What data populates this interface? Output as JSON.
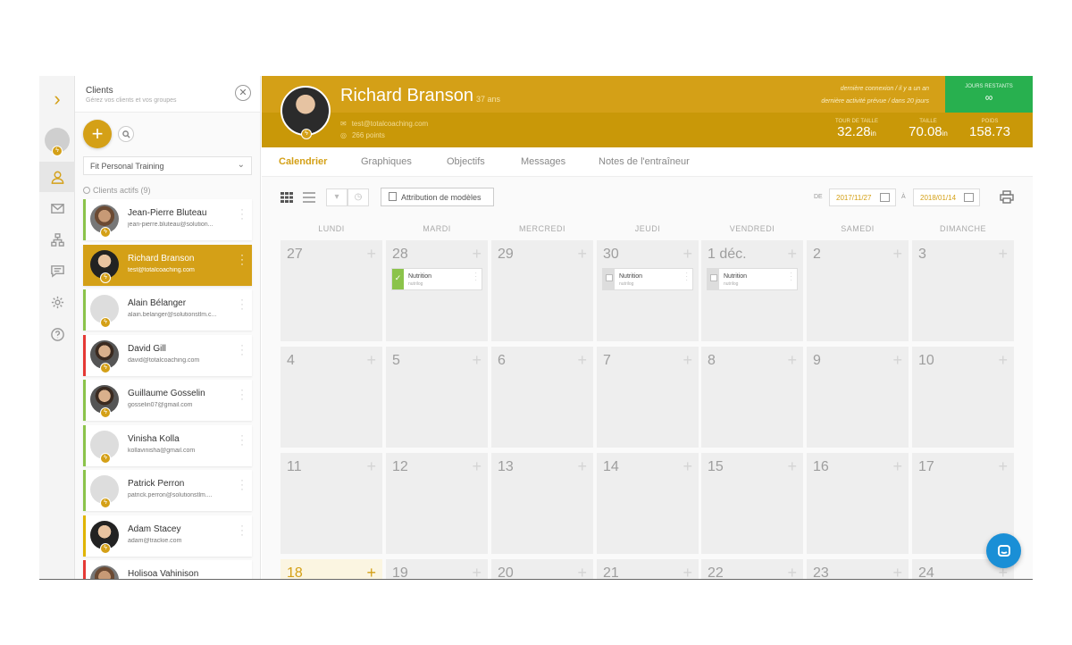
{
  "colors": {
    "accent": "#d4a017",
    "green": "#28b04f",
    "ok": "#8bc34a",
    "danger": "#e53935",
    "chat": "#1a8fd6"
  },
  "rail": {
    "icons": [
      "chevron-right-icon",
      "avatar",
      "clients-icon",
      "mail-icon",
      "hierarchy-icon",
      "chat-icon",
      "gear-icon",
      "help-icon"
    ]
  },
  "clients": {
    "title": "Clients",
    "subtitle": "Gérez vos clients et vos groupes",
    "add": "+",
    "group": "Fit Personal Training",
    "active_label": "Clients actifs",
    "active_count": "(9)",
    "list": [
      {
        "name": "Jean-Pierre Bluteau",
        "email": "jean-pierre.bluteau@solution..."
      },
      {
        "name": "Richard Branson",
        "email": "test@totalcoaching.com"
      },
      {
        "name": "Alain Bélanger",
        "email": "alain.belanger@solutionstlm.c..."
      },
      {
        "name": "David Gill",
        "email": "david@totalcoaching.com"
      },
      {
        "name": "Guillaume Gosselin",
        "email": "gosselin07@gmail.com"
      },
      {
        "name": "Vinisha Kolla",
        "email": "kollavinisha@gmail.com"
      },
      {
        "name": "Patrick Perron",
        "email": "patrick.perron@solutionstlm...."
      },
      {
        "name": "Adam Stacey",
        "email": "adam@trackie.com"
      },
      {
        "name": "Holisoa Vahinison",
        "email": ""
      }
    ]
  },
  "profile": {
    "name": "Richard Branson",
    "age": "37 ans",
    "email": "test@totalcoaching.com",
    "points": "266 points",
    "last_login": "dernière connexion / il y a un an",
    "last_activity": "dernière activité prévue / dans 20 jours",
    "days_left_label": "JOURS RESTANTS",
    "days_left_value": "∞",
    "stats": [
      {
        "label": "TOUR DE TAILLE",
        "value": "32.28",
        "unit": "in"
      },
      {
        "label": "TAILLE",
        "value": "70.08",
        "unit": "in"
      },
      {
        "label": "POIDS",
        "value": "158.73",
        "unit": ""
      }
    ]
  },
  "tabs": [
    "Calendrier",
    "Graphiques",
    "Objectifs",
    "Messages",
    "Notes de l'entraîneur"
  ],
  "toolbar": {
    "templates_button": "Attribution de modèles",
    "from_label": "DE",
    "from_date": "2017/11/27",
    "to_label": "À",
    "to_date": "2018/01/14"
  },
  "calendar": {
    "weekdays": [
      "LUNDI",
      "MARDI",
      "MERCREDI",
      "JEUDI",
      "VENDREDI",
      "SAMEDI",
      "DIMANCHE"
    ],
    "weeks": [
      [
        "27",
        "28",
        "29",
        "30",
        "1 déc.",
        "2",
        "3"
      ],
      [
        "4",
        "5",
        "6",
        "7",
        "8",
        "9",
        "10"
      ],
      [
        "11",
        "12",
        "13",
        "14",
        "15",
        "16",
        "17"
      ],
      [
        "18",
        "19",
        "20",
        "21",
        "22",
        "23",
        "24"
      ]
    ],
    "events": [
      {
        "week": 0,
        "day": 1,
        "title": "Nutrition",
        "sub": "nutrilog",
        "done": true
      },
      {
        "week": 0,
        "day": 3,
        "title": "Nutrition",
        "sub": "nutrilog",
        "done": false
      },
      {
        "week": 0,
        "day": 4,
        "title": "Nutrition",
        "sub": "nutrilog",
        "done": false
      }
    ]
  }
}
